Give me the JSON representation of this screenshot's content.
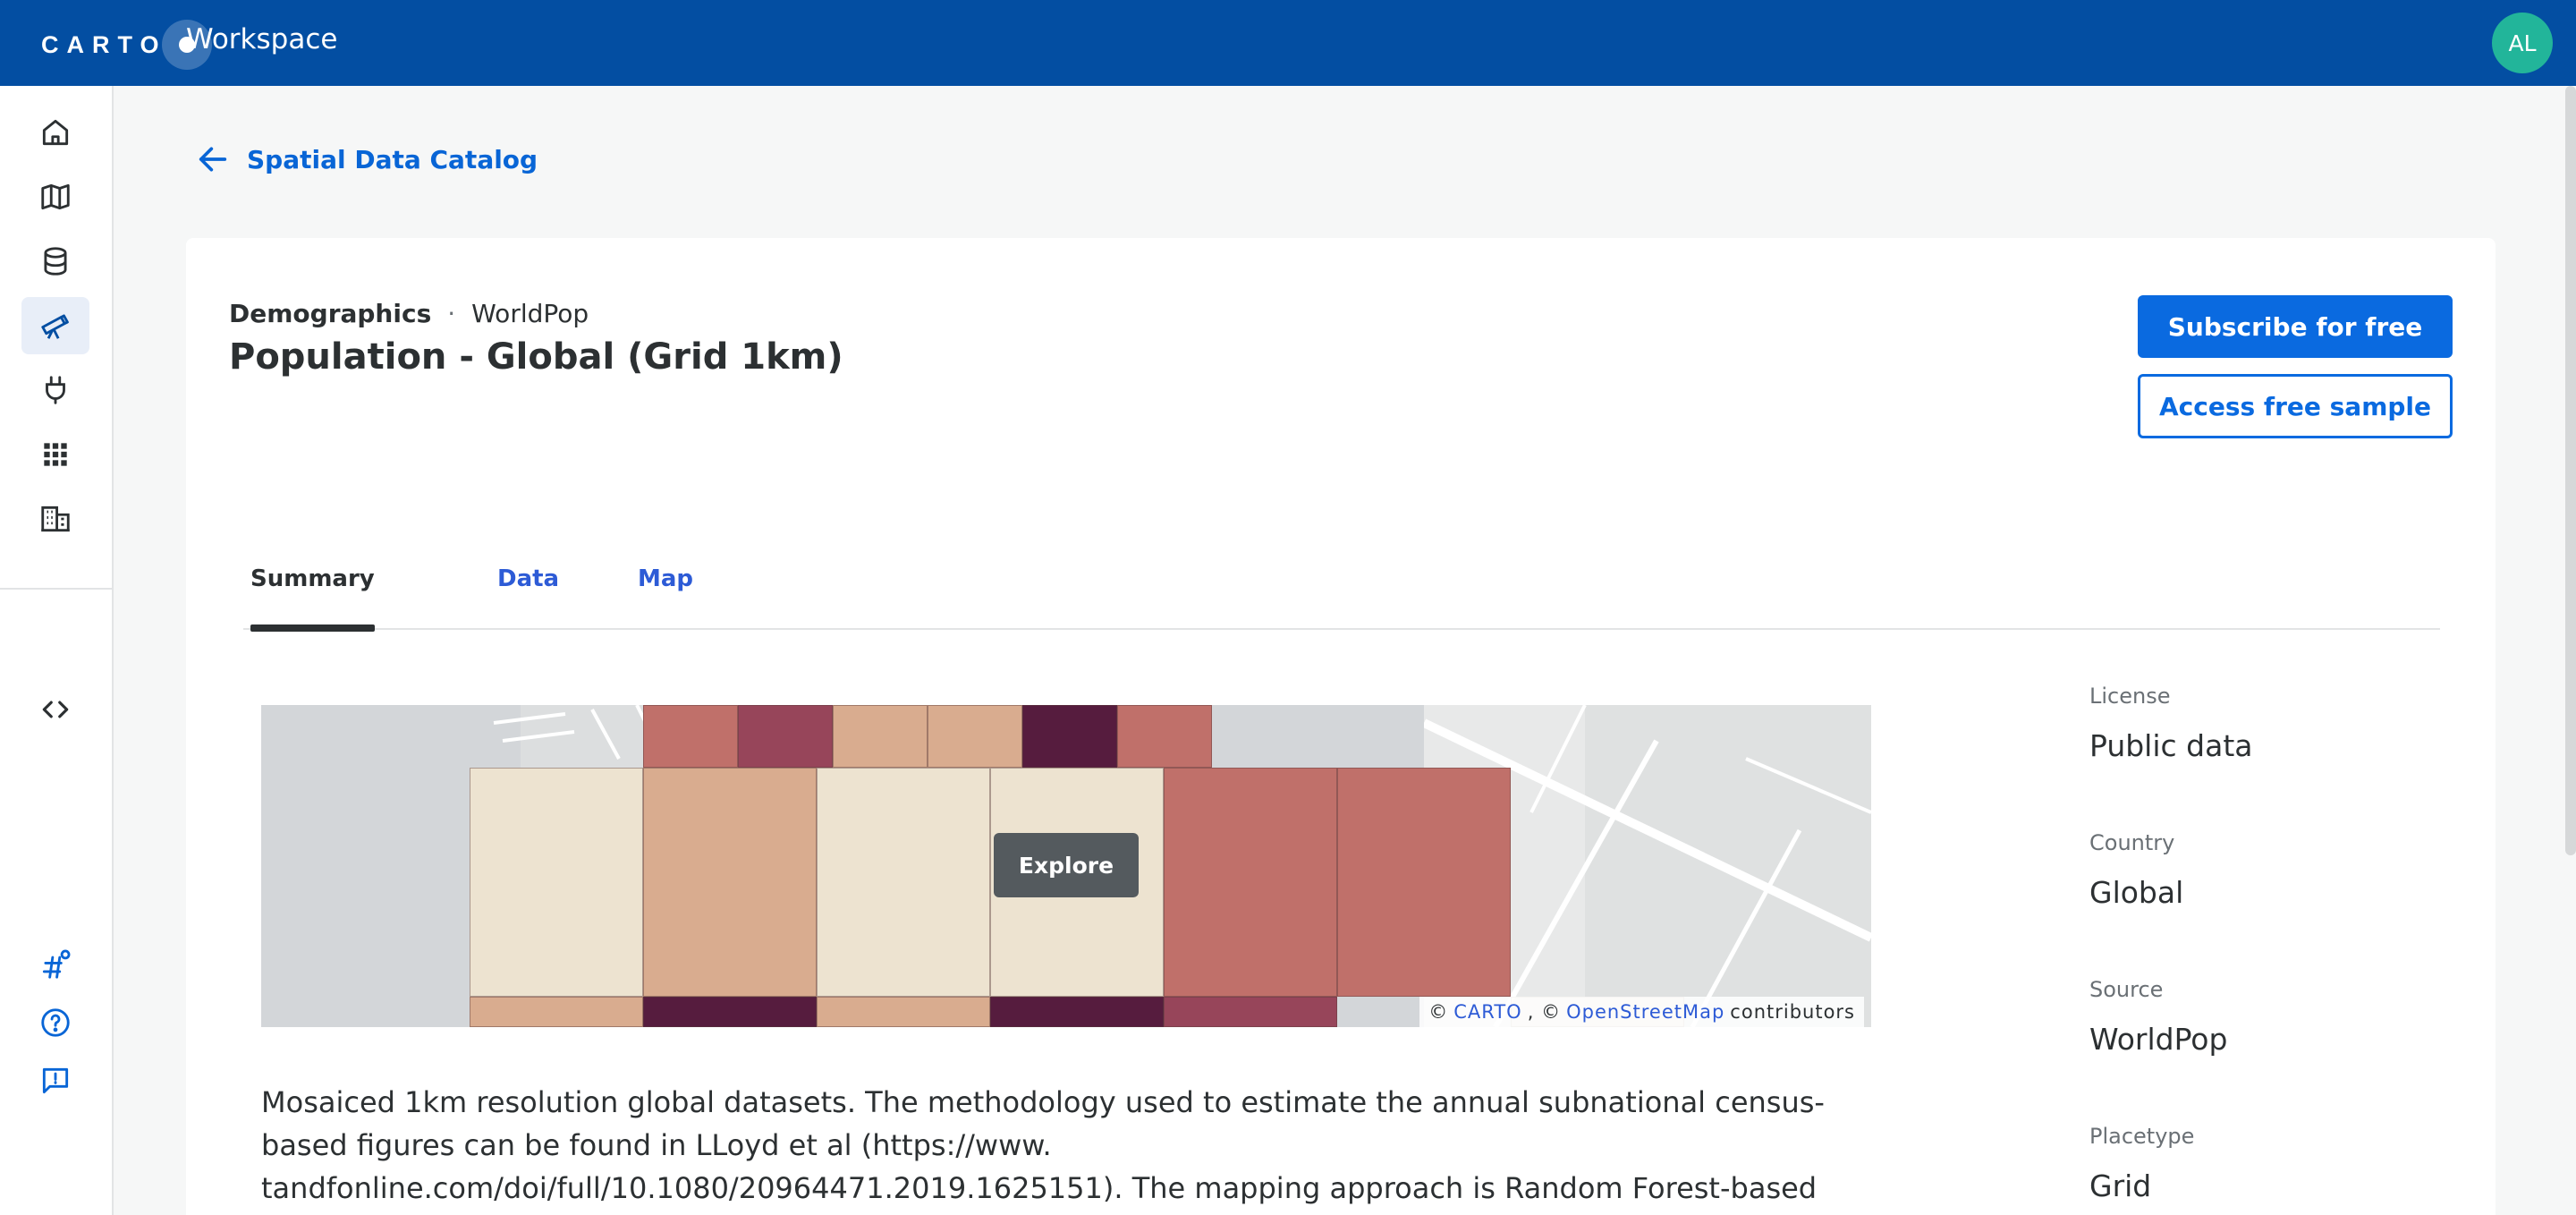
{
  "topbar": {
    "logo_text": "CARTO",
    "workspace_title": "Workspace",
    "avatar_initials": "AL",
    "brand_color": "#034ea2"
  },
  "sidebar": {
    "items": [
      {
        "icon": "home-icon"
      },
      {
        "icon": "map-icon"
      },
      {
        "icon": "database-icon"
      },
      {
        "icon": "telescope-icon",
        "active": true
      },
      {
        "icon": "plug-icon"
      },
      {
        "icon": "apps-grid-icon"
      },
      {
        "icon": "building-icon"
      },
      {
        "icon": "code-icon"
      },
      {
        "icon": "hashtag-icon"
      },
      {
        "icon": "help-icon"
      },
      {
        "icon": "feedback-icon"
      }
    ]
  },
  "breadcrumb": {
    "back_label": "Spatial Data Catalog"
  },
  "dataset": {
    "category": "Demographics",
    "separator": "·",
    "provider": "WorldPop",
    "title": "Population - Global (Grid 1km)"
  },
  "actions": {
    "subscribe_label": "Subscribe for free",
    "sample_label": "Access free sample"
  },
  "tabs": [
    {
      "label": "Summary",
      "active": true
    },
    {
      "label": "Data",
      "active": false
    },
    {
      "label": "Map",
      "active": false
    }
  ],
  "map_preview": {
    "explore_label": "Explore",
    "attribution_prefix": "©",
    "attribution_carto": "CARTO",
    "attribution_mid": ", ©",
    "attribution_osm": "OpenStreetMap",
    "attribution_suffix": "contributors"
  },
  "description": "Mosaiced 1km resolution global datasets. The methodology used to estimate the annual subnational census-based figures can be found in LLoyd et al (https://www. tandfonline.com/doi/full/10.1080/20964471.2019.1625151). The mapping approach is Random Forest-based dasymetric redistribution. More info at: www.worldpop.org.",
  "info": [
    {
      "label": "License",
      "value": "Public data"
    },
    {
      "label": "Country",
      "value": "Global"
    },
    {
      "label": "Source",
      "value": "WorldPop"
    },
    {
      "label": "Placetype",
      "value": "Grid"
    }
  ]
}
